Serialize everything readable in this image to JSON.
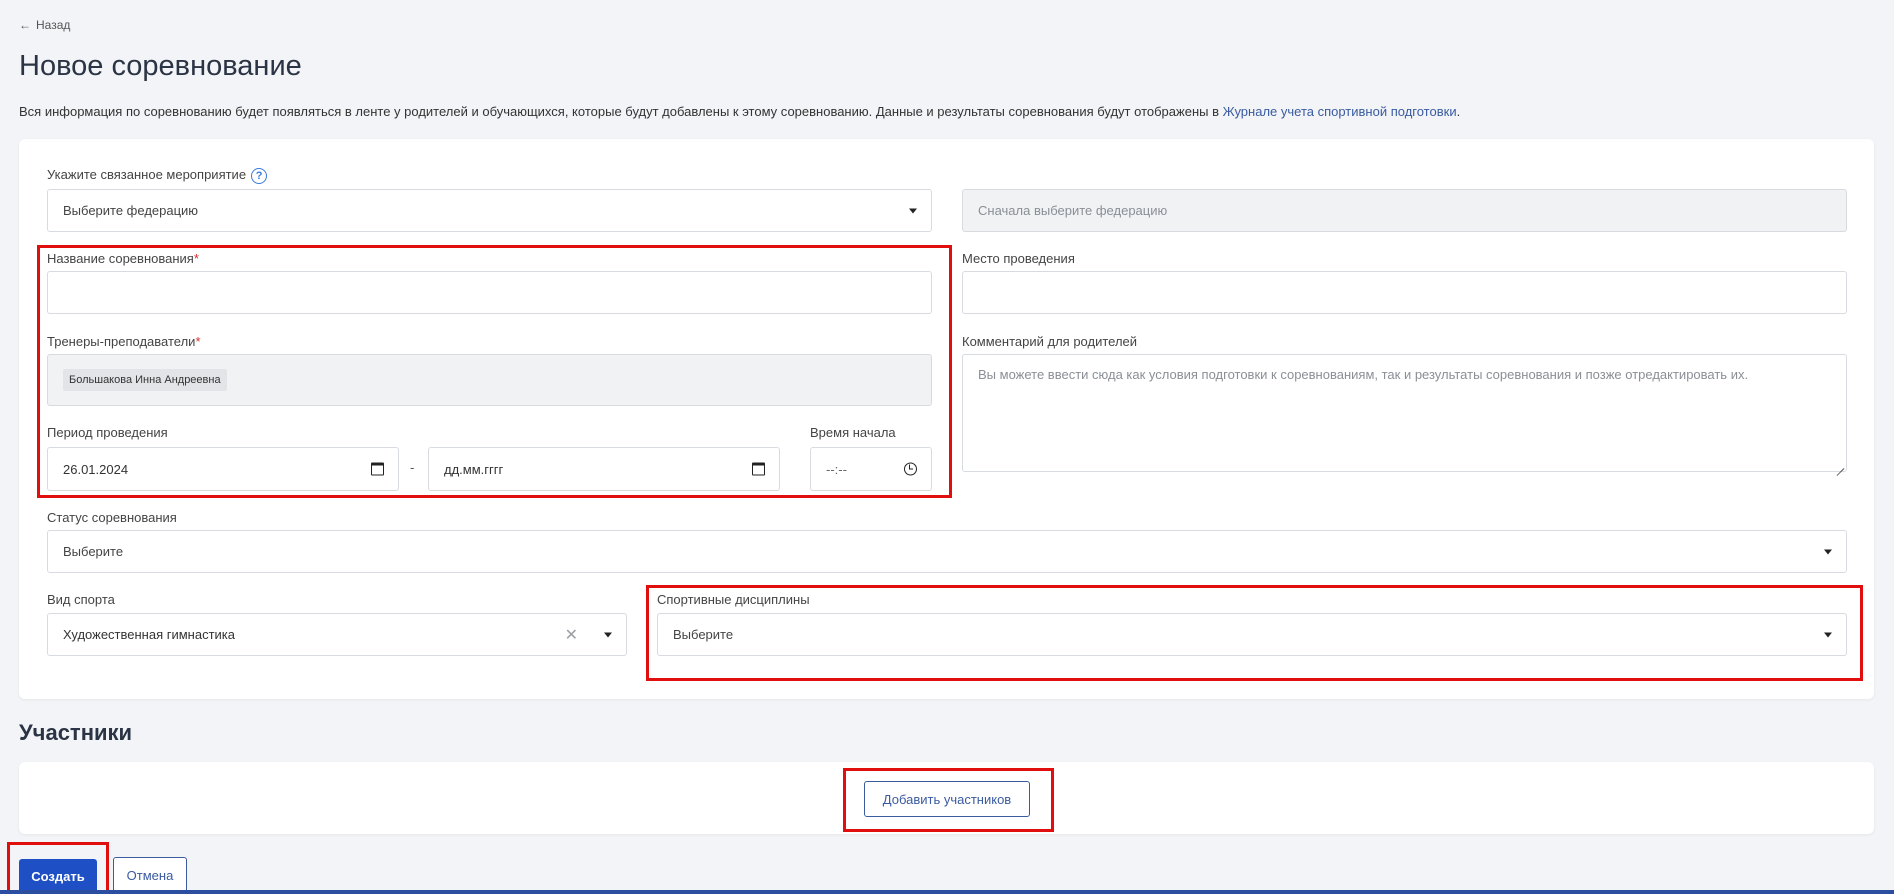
{
  "nav": {
    "back_label": "Назад"
  },
  "header": {
    "title": "Новое соревнование",
    "description": "Вся информация по соревнованию будет появляться в ленте у родителей и обучающихся, которые будут добавлены к этому соревнованию. Данные и результаты соревнования будут отображены в ",
    "description_link": "Журнале учета спортивной подготовки",
    "description_end": "."
  },
  "form": {
    "related_event_label": "Укажите связанное мероприятие",
    "federation_placeholder": "Выберите федерацию",
    "event_placeholder_disabled": "Сначала выберите федерацию",
    "name_label": "Название соревнования",
    "name_value": "",
    "venue_label": "Место проведения",
    "venue_value": "",
    "trainers_label": "Тренеры-преподаватели",
    "trainers": [
      "Большакова Инна Андреевна"
    ],
    "comment_label": "Комментарий для родителей",
    "comment_placeholder": "Вы можете ввести сюда как условия подготовки к соревнованиям, так и результаты соревнования и позже отредактировать их.",
    "period_label": "Период проведения",
    "date_from": "26.01.2024",
    "date_separator": "-",
    "date_to_placeholder": "дд.мм.гггг",
    "start_time_label": "Время начала",
    "start_time_placeholder": "--:--",
    "status_label": "Статус соревнования",
    "status_placeholder": "Выберите",
    "sport_label": "Вид спорта",
    "sport_value": "Художественная гимнастика",
    "disciplines_label": "Спортивные дисциплины",
    "disciplines_placeholder": "Выберите",
    "required_mark": "*"
  },
  "participants": {
    "title": "Участники",
    "add_button": "Добавить участников"
  },
  "actions": {
    "create": "Создать",
    "cancel": "Отмена"
  },
  "colors": {
    "accent": "#1f4fc4",
    "link": "#3a5ba0",
    "highlight": "#e10e0e",
    "required": "#d32f2f"
  }
}
